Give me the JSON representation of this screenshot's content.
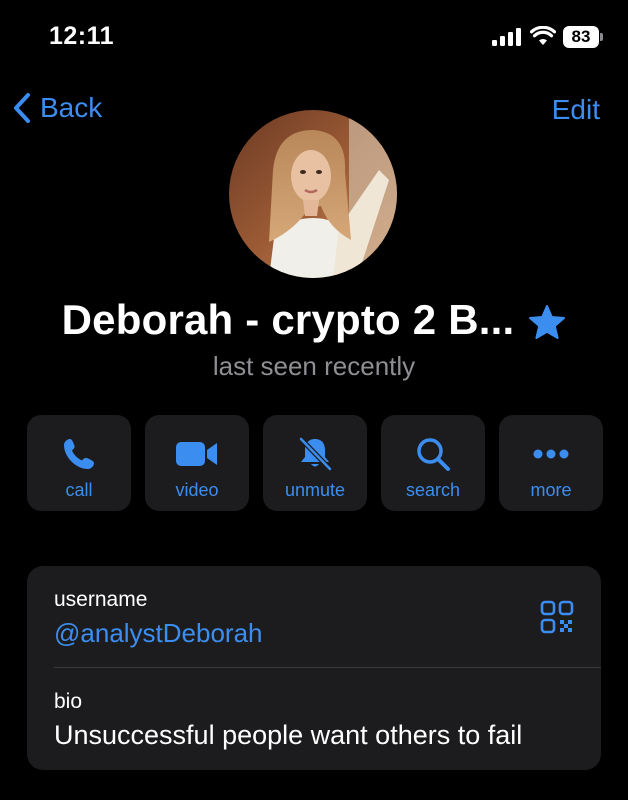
{
  "status_bar": {
    "time": "12:11",
    "battery": "83"
  },
  "nav": {
    "back_label": "Back",
    "edit_label": "Edit"
  },
  "profile": {
    "name": "Deborah - crypto 2 B...",
    "status": "last seen recently",
    "favorite": true
  },
  "actions": [
    {
      "label": "call",
      "icon": "phone-icon"
    },
    {
      "label": "video",
      "icon": "video-camera-icon"
    },
    {
      "label": "unmute",
      "icon": "bell-slash-icon"
    },
    {
      "label": "search",
      "icon": "search-icon"
    },
    {
      "label": "more",
      "icon": "ellipsis-icon"
    }
  ],
  "info": {
    "username_label": "username",
    "username_value": "@analystDeborah",
    "bio_label": "bio",
    "bio_value": "Unsuccessful people want others to fail"
  },
  "colors": {
    "accent": "#3b8ef0",
    "card": "#1c1c1e",
    "secondary_text": "#8e8e93",
    "background": "#000000"
  }
}
